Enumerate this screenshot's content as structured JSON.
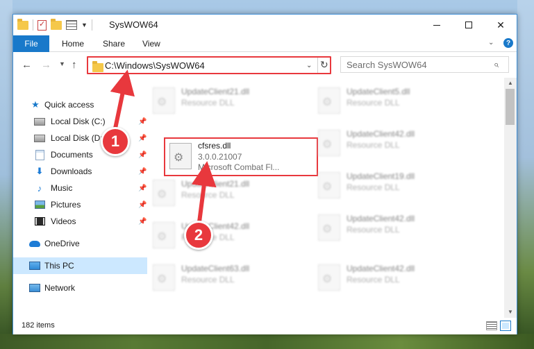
{
  "window": {
    "title": "SysWOW64"
  },
  "ribbon": {
    "file": "File",
    "tabs": [
      "Home",
      "Share",
      "View"
    ]
  },
  "address": {
    "path": "C:\\Windows\\SysWOW64"
  },
  "search": {
    "placeholder": "Search SysWOW64"
  },
  "nav": {
    "items": [
      {
        "label": "Quick access",
        "icon": "star-icon",
        "pinned": false
      },
      {
        "label": "Local Disk (C:)",
        "icon": "disk-icon",
        "pinned": true
      },
      {
        "label": "Local Disk (D:)",
        "icon": "disk-icon",
        "pinned": true
      },
      {
        "label": "Documents",
        "icon": "documents-icon",
        "pinned": true
      },
      {
        "label": "Downloads",
        "icon": "download-icon",
        "pinned": true
      },
      {
        "label": "Music",
        "icon": "music-icon",
        "pinned": true
      },
      {
        "label": "Pictures",
        "icon": "pictures-icon",
        "pinned": true
      },
      {
        "label": "Videos",
        "icon": "videos-icon",
        "pinned": true
      },
      {
        "label": "OneDrive",
        "icon": "cloud-icon",
        "pinned": false
      },
      {
        "label": "This PC",
        "icon": "computer-icon",
        "pinned": false,
        "selected": true
      },
      {
        "label": "Network",
        "icon": "network-icon",
        "pinned": false
      }
    ]
  },
  "files": {
    "highlighted": {
      "name": "cfsres.dll",
      "version": "3.0.0.21007",
      "description": "Microsoft Combat Fl..."
    },
    "col1": [
      {
        "name": "UpdateClient21.dll",
        "type": "Resource DLL"
      },
      {
        "name": "UpdateClient21.dll",
        "type": "Resource DLL"
      },
      {
        "name": "UpdateClient42.dll",
        "type": "Resource DLL"
      },
      {
        "name": "UpdateClient63.dll",
        "type": "Resource DLL"
      }
    ],
    "col2": [
      {
        "name": "UpdateClient5.dll",
        "type": "Resource DLL"
      },
      {
        "name": "UpdateClient42.dll",
        "type": "Resource DLL"
      },
      {
        "name": "UpdateClient19.dll",
        "type": "Resource DLL"
      },
      {
        "name": "UpdateClient42.dll",
        "type": "Resource DLL"
      },
      {
        "name": "UpdateClient42.dll",
        "type": "Resource DLL"
      }
    ]
  },
  "status": {
    "count": "182 items"
  },
  "annotations": {
    "step1": "1",
    "step2": "2",
    "color": "#e8383d"
  }
}
